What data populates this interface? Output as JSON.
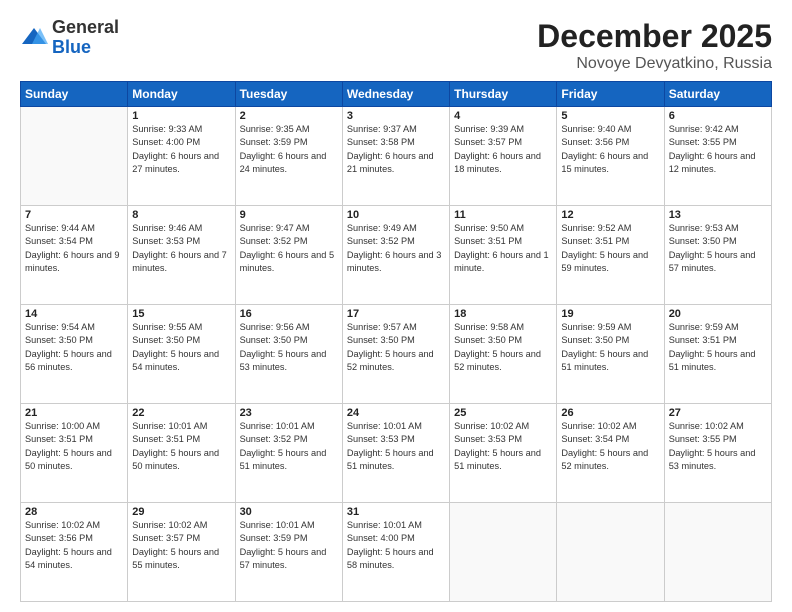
{
  "logo": {
    "general": "General",
    "blue": "Blue"
  },
  "title": "December 2025",
  "location": "Novoye Devyatkino, Russia",
  "days_header": [
    "Sunday",
    "Monday",
    "Tuesday",
    "Wednesday",
    "Thursday",
    "Friday",
    "Saturday"
  ],
  "weeks": [
    [
      {
        "day": "",
        "info": ""
      },
      {
        "day": "1",
        "info": "Sunrise: 9:33 AM\nSunset: 4:00 PM\nDaylight: 6 hours\nand 27 minutes."
      },
      {
        "day": "2",
        "info": "Sunrise: 9:35 AM\nSunset: 3:59 PM\nDaylight: 6 hours\nand 24 minutes."
      },
      {
        "day": "3",
        "info": "Sunrise: 9:37 AM\nSunset: 3:58 PM\nDaylight: 6 hours\nand 21 minutes."
      },
      {
        "day": "4",
        "info": "Sunrise: 9:39 AM\nSunset: 3:57 PM\nDaylight: 6 hours\nand 18 minutes."
      },
      {
        "day": "5",
        "info": "Sunrise: 9:40 AM\nSunset: 3:56 PM\nDaylight: 6 hours\nand 15 minutes."
      },
      {
        "day": "6",
        "info": "Sunrise: 9:42 AM\nSunset: 3:55 PM\nDaylight: 6 hours\nand 12 minutes."
      }
    ],
    [
      {
        "day": "7",
        "info": "Sunrise: 9:44 AM\nSunset: 3:54 PM\nDaylight: 6 hours\nand 9 minutes."
      },
      {
        "day": "8",
        "info": "Sunrise: 9:46 AM\nSunset: 3:53 PM\nDaylight: 6 hours\nand 7 minutes."
      },
      {
        "day": "9",
        "info": "Sunrise: 9:47 AM\nSunset: 3:52 PM\nDaylight: 6 hours\nand 5 minutes."
      },
      {
        "day": "10",
        "info": "Sunrise: 9:49 AM\nSunset: 3:52 PM\nDaylight: 6 hours\nand 3 minutes."
      },
      {
        "day": "11",
        "info": "Sunrise: 9:50 AM\nSunset: 3:51 PM\nDaylight: 6 hours\nand 1 minute."
      },
      {
        "day": "12",
        "info": "Sunrise: 9:52 AM\nSunset: 3:51 PM\nDaylight: 5 hours\nand 59 minutes."
      },
      {
        "day": "13",
        "info": "Sunrise: 9:53 AM\nSunset: 3:50 PM\nDaylight: 5 hours\nand 57 minutes."
      }
    ],
    [
      {
        "day": "14",
        "info": "Sunrise: 9:54 AM\nSunset: 3:50 PM\nDaylight: 5 hours\nand 56 minutes."
      },
      {
        "day": "15",
        "info": "Sunrise: 9:55 AM\nSunset: 3:50 PM\nDaylight: 5 hours\nand 54 minutes."
      },
      {
        "day": "16",
        "info": "Sunrise: 9:56 AM\nSunset: 3:50 PM\nDaylight: 5 hours\nand 53 minutes."
      },
      {
        "day": "17",
        "info": "Sunrise: 9:57 AM\nSunset: 3:50 PM\nDaylight: 5 hours\nand 52 minutes."
      },
      {
        "day": "18",
        "info": "Sunrise: 9:58 AM\nSunset: 3:50 PM\nDaylight: 5 hours\nand 52 minutes."
      },
      {
        "day": "19",
        "info": "Sunrise: 9:59 AM\nSunset: 3:50 PM\nDaylight: 5 hours\nand 51 minutes."
      },
      {
        "day": "20",
        "info": "Sunrise: 9:59 AM\nSunset: 3:51 PM\nDaylight: 5 hours\nand 51 minutes."
      }
    ],
    [
      {
        "day": "21",
        "info": "Sunrise: 10:00 AM\nSunset: 3:51 PM\nDaylight: 5 hours\nand 50 minutes."
      },
      {
        "day": "22",
        "info": "Sunrise: 10:01 AM\nSunset: 3:51 PM\nDaylight: 5 hours\nand 50 minutes."
      },
      {
        "day": "23",
        "info": "Sunrise: 10:01 AM\nSunset: 3:52 PM\nDaylight: 5 hours\nand 51 minutes."
      },
      {
        "day": "24",
        "info": "Sunrise: 10:01 AM\nSunset: 3:53 PM\nDaylight: 5 hours\nand 51 minutes."
      },
      {
        "day": "25",
        "info": "Sunrise: 10:02 AM\nSunset: 3:53 PM\nDaylight: 5 hours\nand 51 minutes."
      },
      {
        "day": "26",
        "info": "Sunrise: 10:02 AM\nSunset: 3:54 PM\nDaylight: 5 hours\nand 52 minutes."
      },
      {
        "day": "27",
        "info": "Sunrise: 10:02 AM\nSunset: 3:55 PM\nDaylight: 5 hours\nand 53 minutes."
      }
    ],
    [
      {
        "day": "28",
        "info": "Sunrise: 10:02 AM\nSunset: 3:56 PM\nDaylight: 5 hours\nand 54 minutes."
      },
      {
        "day": "29",
        "info": "Sunrise: 10:02 AM\nSunset: 3:57 PM\nDaylight: 5 hours\nand 55 minutes."
      },
      {
        "day": "30",
        "info": "Sunrise: 10:01 AM\nSunset: 3:59 PM\nDaylight: 5 hours\nand 57 minutes."
      },
      {
        "day": "31",
        "info": "Sunrise: 10:01 AM\nSunset: 4:00 PM\nDaylight: 5 hours\nand 58 minutes."
      },
      {
        "day": "",
        "info": ""
      },
      {
        "day": "",
        "info": ""
      },
      {
        "day": "",
        "info": ""
      }
    ]
  ]
}
